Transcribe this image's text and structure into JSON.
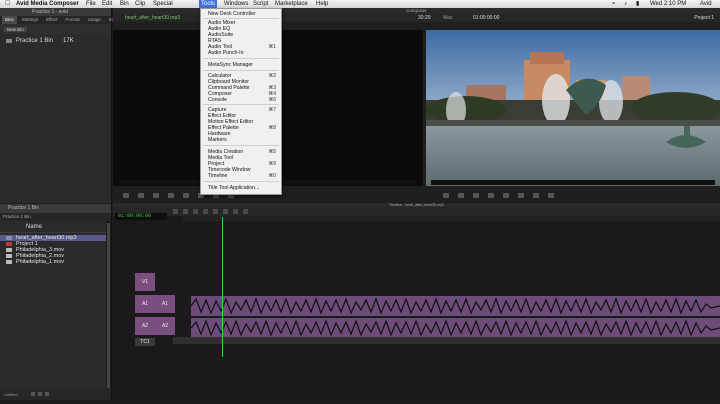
{
  "menubar": {
    "app_name": "Avid Media Composer",
    "menus": [
      "File",
      "Edit",
      "Bin",
      "Clip",
      "Special",
      "Tools",
      "Windows",
      "Script",
      "Marketplace",
      "Help"
    ],
    "clock": "Wed 2:10 PM",
    "user": "Avid"
  },
  "project_window": {
    "title": "Practice 1 - avid",
    "tabs": [
      "Bins",
      "Settings",
      "Effect",
      "Format",
      "Usage",
      "Info"
    ],
    "new_bin_label": "New Bin",
    "bin_name": "Practice 1 Bin",
    "bin_size": "17K"
  },
  "bin_window": {
    "title": "Practice 1 Bin",
    "tab": "Practice 1 Bin",
    "column": "Name",
    "clips": [
      {
        "name": "heart_after_heart30.mp3",
        "color": "#8a8ab0"
      },
      {
        "name": "Project 1",
        "color": "#c0392b"
      },
      {
        "name": "Philadelphia_3.mov",
        "color": "#bbbbbb"
      },
      {
        "name": "Philadelphia_2.mov",
        "color": "#bbbbbb"
      },
      {
        "name": "Philadelphia_1.mov",
        "color": "#bbbbbb"
      }
    ],
    "footer": "Untitled"
  },
  "composer": {
    "title": "Composer",
    "source_clip": "heart_after_heart30.mp3",
    "source_tc": "30:20",
    "mas_label": "Mas",
    "record_tc": "01:00:00:00",
    "project": "Project 1"
  },
  "timeline": {
    "title": "Timeline - heart_after_heart30.mp3",
    "timecode": "01:00:00:00",
    "tracks": [
      "V1",
      "A1",
      "A2",
      "TC1"
    ],
    "rec_tracks": [
      "A1",
      "A2"
    ]
  },
  "tools_menu": {
    "items": [
      {
        "label": "New Deck Controller",
        "shortcut": ""
      },
      {
        "label": "Audio Mixer",
        "shortcut": ""
      },
      {
        "label": "Audio EQ",
        "shortcut": ""
      },
      {
        "label": "AudioSuite",
        "shortcut": ""
      },
      {
        "label": "RTAS",
        "shortcut": ""
      },
      {
        "label": "Audio Tool",
        "shortcut": "⌘1"
      },
      {
        "label": "Audio Punch-In",
        "shortcut": ""
      },
      {
        "label": "MetaSync Manager",
        "shortcut": ""
      },
      {
        "label": "Calculator",
        "shortcut": "⌘2"
      },
      {
        "label": "Clipboard Monitor",
        "shortcut": ""
      },
      {
        "label": "Command Palette",
        "shortcut": "⌘3"
      },
      {
        "label": "Composer",
        "shortcut": "⌘4"
      },
      {
        "label": "Console",
        "shortcut": "⌘6"
      },
      {
        "label": "Capture",
        "shortcut": "⌘7"
      },
      {
        "label": "Effect Editor",
        "shortcut": ""
      },
      {
        "label": "Motion Effect Editor",
        "shortcut": ""
      },
      {
        "label": "Effect Palette",
        "shortcut": "⌘8"
      },
      {
        "label": "Hardware",
        "shortcut": ""
      },
      {
        "label": "Markers",
        "shortcut": ""
      },
      {
        "label": "Media Creation",
        "shortcut": "⌘5"
      },
      {
        "label": "Media Tool",
        "shortcut": ""
      },
      {
        "label": "Project",
        "shortcut": "⌘9"
      },
      {
        "label": "Timecode Window",
        "shortcut": ""
      },
      {
        "label": "Timeline",
        "shortcut": "⌘0"
      },
      {
        "label": "Title Tool Application...",
        "shortcut": ""
      }
    ]
  }
}
